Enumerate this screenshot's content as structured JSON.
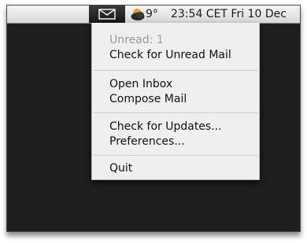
{
  "menubar": {
    "mail_icon": "envelope-icon",
    "weather_icon": "weather-cloud-icon",
    "temperature": "9°",
    "clock": "23:54 CET Fri 10 Dec"
  },
  "menu": {
    "items": [
      {
        "label": "Unread: 1",
        "enabled": false
      },
      {
        "label": "Check for Unread Mail",
        "enabled": true
      },
      {
        "label": "Open Inbox",
        "enabled": true
      },
      {
        "label": "Compose Mail",
        "enabled": true
      },
      {
        "label": "Check for Updates...",
        "enabled": true
      },
      {
        "label": "Preferences...",
        "enabled": true
      },
      {
        "label": "Quit",
        "enabled": true
      }
    ]
  }
}
